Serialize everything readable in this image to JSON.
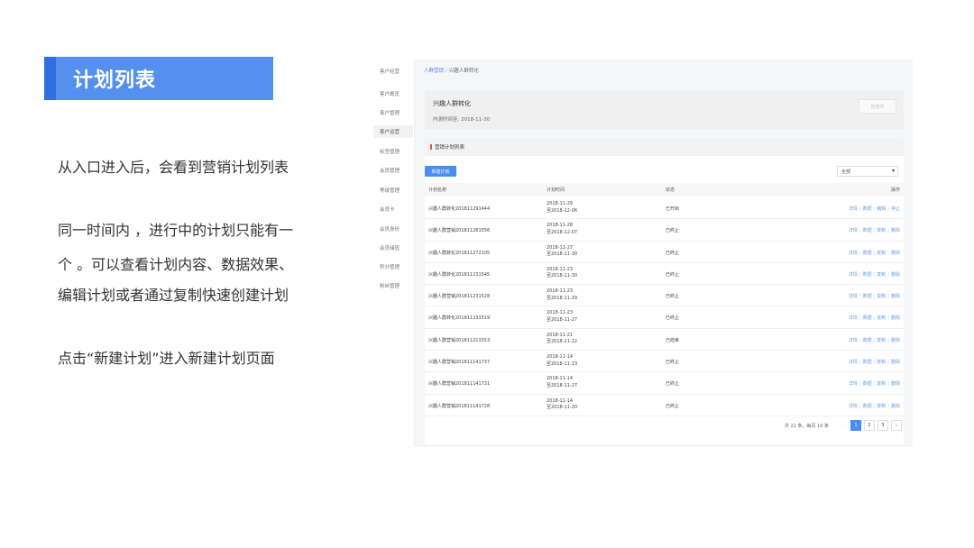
{
  "slide": {
    "title": "计划列表",
    "desc1": "从入口进入后，会看到营销计划列表",
    "desc2": "同一时间内 ，进行中的计划只能有一",
    "desc3": "个 。可以查看计划内容、数据效果、",
    "desc4": "编辑计划或者通过复制快速创建计划",
    "desc5": "点击“新建计划”进入新建计划页面"
  },
  "sidebar": {
    "items": [
      "客户经营",
      "客户概览",
      "客户管理",
      "客户运营",
      "标签管理",
      "会员管理",
      "等级管理",
      "会员卡",
      "会员身份",
      "会员储值",
      "积分管理",
      "粉丝管理"
    ]
  },
  "breadcrumb": {
    "parent": "人群营销",
    "current": "兴趣人群转化"
  },
  "info": {
    "name": "兴趣人群转化",
    "time": "内测时间至:   2018-11-30",
    "button": "创建中"
  },
  "list": {
    "section_title": "营销计划列表",
    "new_button": "新建计划",
    "filter_value": "全部",
    "columns": {
      "name": "计划名称",
      "time": "计划时间",
      "status": "状态",
      "ops": "操作"
    },
    "rows": [
      {
        "name": "兴趣人群转化201811291444",
        "start": "2018-11-29",
        "end": "至2018-12-06",
        "status": "已开启",
        "ops": [
          "详情",
          "数据",
          "编辑",
          "停止"
        ]
      },
      {
        "name": "兴趣人群营销201811281556",
        "start": "2018-11-28",
        "end": "至2018-12-07",
        "status": "已终止",
        "ops": [
          "详情",
          "数据",
          "复制",
          "删除"
        ]
      },
      {
        "name": "兴趣人群转化201811272105",
        "start": "2018-11-27",
        "end": "至2018-11-30",
        "status": "已终止",
        "ops": [
          "详情",
          "数据",
          "复制",
          "删除"
        ]
      },
      {
        "name": "兴趣人群转化201811231545",
        "start": "2018-11-23",
        "end": "至2018-11-30",
        "status": "已终止",
        "ops": [
          "详情",
          "数据",
          "复制",
          "删除"
        ]
      },
      {
        "name": "兴趣人群营销201811231528",
        "start": "2018-11-23",
        "end": "至2018-11-29",
        "status": "已终止",
        "ops": [
          "详情",
          "数据",
          "复制",
          "删除"
        ]
      },
      {
        "name": "兴趣人群转化201811231519",
        "start": "2018-11-23",
        "end": "至2018-11-27",
        "status": "已终止",
        "ops": [
          "详情",
          "数据",
          "复制",
          "删除"
        ]
      },
      {
        "name": "兴趣人群营销201811211553",
        "start": "2018-11-21",
        "end": "至2018-11-22",
        "status": "已结束",
        "ops": [
          "详情",
          "数据",
          "复制",
          "删除"
        ]
      },
      {
        "name": "兴趣人群营销201811141737",
        "start": "2018-11-14",
        "end": "至2018-11-23",
        "status": "已终止",
        "ops": [
          "详情",
          "数据",
          "复制",
          "删除"
        ]
      },
      {
        "name": "兴趣人群营销201811141731",
        "start": "2018-11-14",
        "end": "至2018-11-27",
        "status": "已终止",
        "ops": [
          "详情",
          "数据",
          "复制",
          "删除"
        ]
      },
      {
        "name": "兴趣人群营销201811141728",
        "start": "2018-11-14",
        "end": "至2018-11-20",
        "status": "已终止",
        "ops": [
          "详情",
          "数据",
          "复制",
          "删除"
        ]
      }
    ],
    "pager": {
      "info": "共 22 条，每页 10 条",
      "prev": "‹",
      "pages": [
        "1",
        "2",
        "3"
      ],
      "next": "›"
    }
  }
}
